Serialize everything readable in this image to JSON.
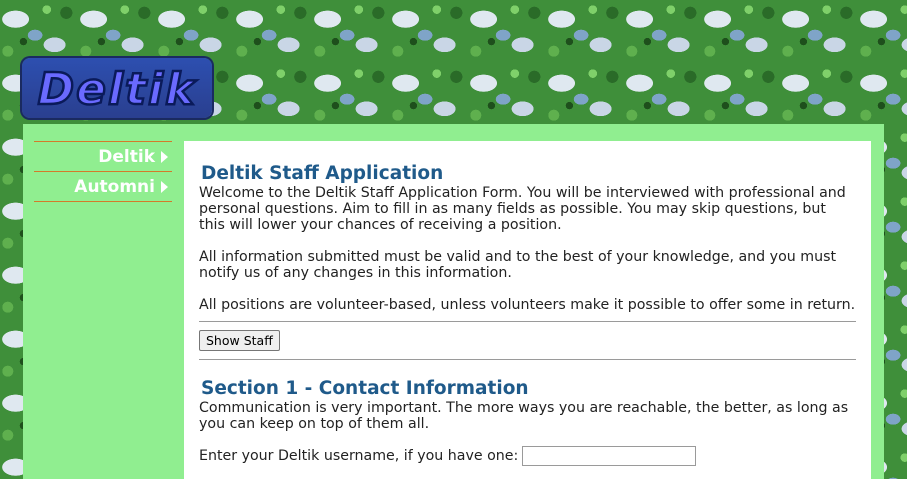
{
  "logo": {
    "text": "Deltik"
  },
  "sidebar": {
    "items": [
      {
        "label": "Deltik"
      },
      {
        "label": "Automni"
      }
    ]
  },
  "main": {
    "title": "Deltik Staff Application",
    "intro": "Welcome to the Deltik Staff Application Form. You will be interviewed with professional and personal questions. Aim to fill in as many fields as possible. You may skip questions, but this will lower your chances of receiving a position.",
    "valid_info": "All information submitted must be valid and to the best of your knowledge, and you must notify us of any changes in this information.",
    "volunteer": "All positions are volunteer-based, unless volunteers make it possible to offer some in return.",
    "show_staff_label": "Show Staff",
    "section1": {
      "title": "Section 1 - Contact Information",
      "description": "Communication is very important. The more ways you are reachable, the better, as long as you can keep on top of them all.",
      "username_label": "Enter your Deltik username, if you have one:",
      "username_value": ""
    }
  },
  "colors": {
    "sidebar_bg": "#90ee90",
    "heading": "#1f5a8a",
    "divider": "#d47a2a"
  }
}
